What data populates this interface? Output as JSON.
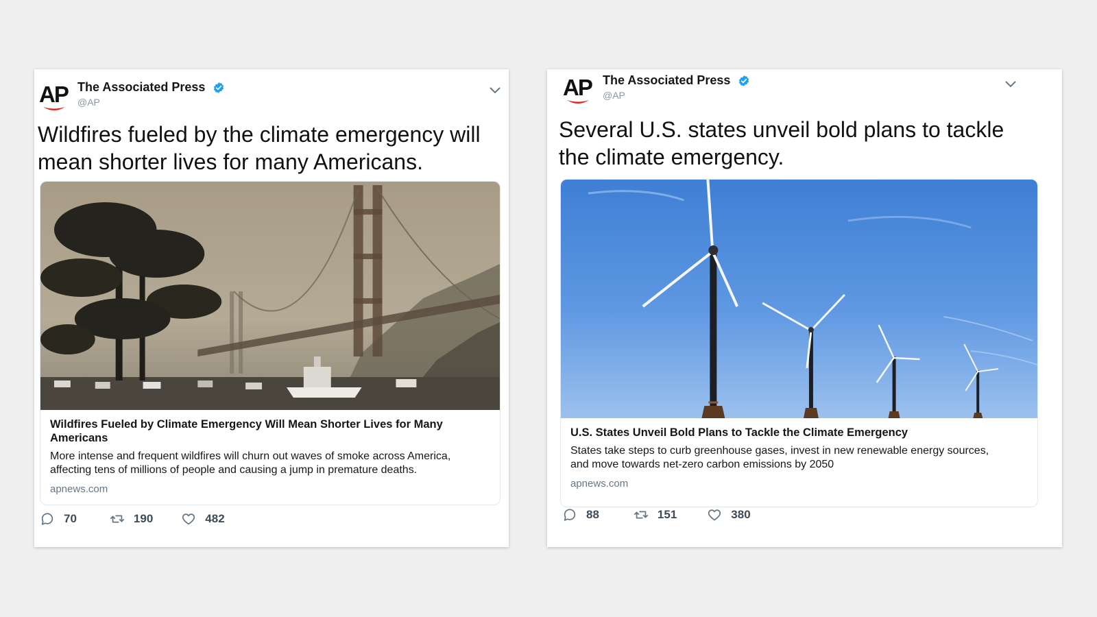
{
  "tweets": [
    {
      "logo": "AP",
      "author_name": "The Associated Press",
      "handle": "@AP",
      "verified_icon": "verified-badge-icon",
      "headline": "Wildfires fueled by the climate emergency will mean shorter lives for many Americans.",
      "card": {
        "image": "golden-gate-bridge-in-wildfire-smoke-photo",
        "title": "Wildfires Fueled by Climate Emergency Will Mean Shorter Lives for Many Americans",
        "description": "More intense and frequent wildfires will churn out waves of smoke across America, affecting tens of millions of people and causing a jump in premature deaths.",
        "domain": "apnews.com"
      },
      "replies": "70",
      "retweets": "190",
      "likes": "482"
    },
    {
      "logo": "AP",
      "author_name": "The Associated Press",
      "handle": "@AP",
      "verified_icon": "verified-badge-icon",
      "headline": "Several U.S. states unveil bold plans to tackle the climate emergency.",
      "card": {
        "image": "offshore-wind-turbines-photo",
        "title": "U.S. States Unveil Bold Plans to Tackle the Climate Emergency",
        "description": "States take steps to curb greenhouse gases, invest in new renewable energy sources, and move towards net-zero carbon emissions by 2050",
        "domain": "apnews.com"
      },
      "replies": "88",
      "retweets": "151",
      "likes": "380"
    }
  ],
  "colors": {
    "page_background": "#efefef",
    "verified_blue": "#1da1f2",
    "ap_red": "#e2231a",
    "icon_gray": "#657786",
    "handle_gray": "#8a96a3"
  }
}
